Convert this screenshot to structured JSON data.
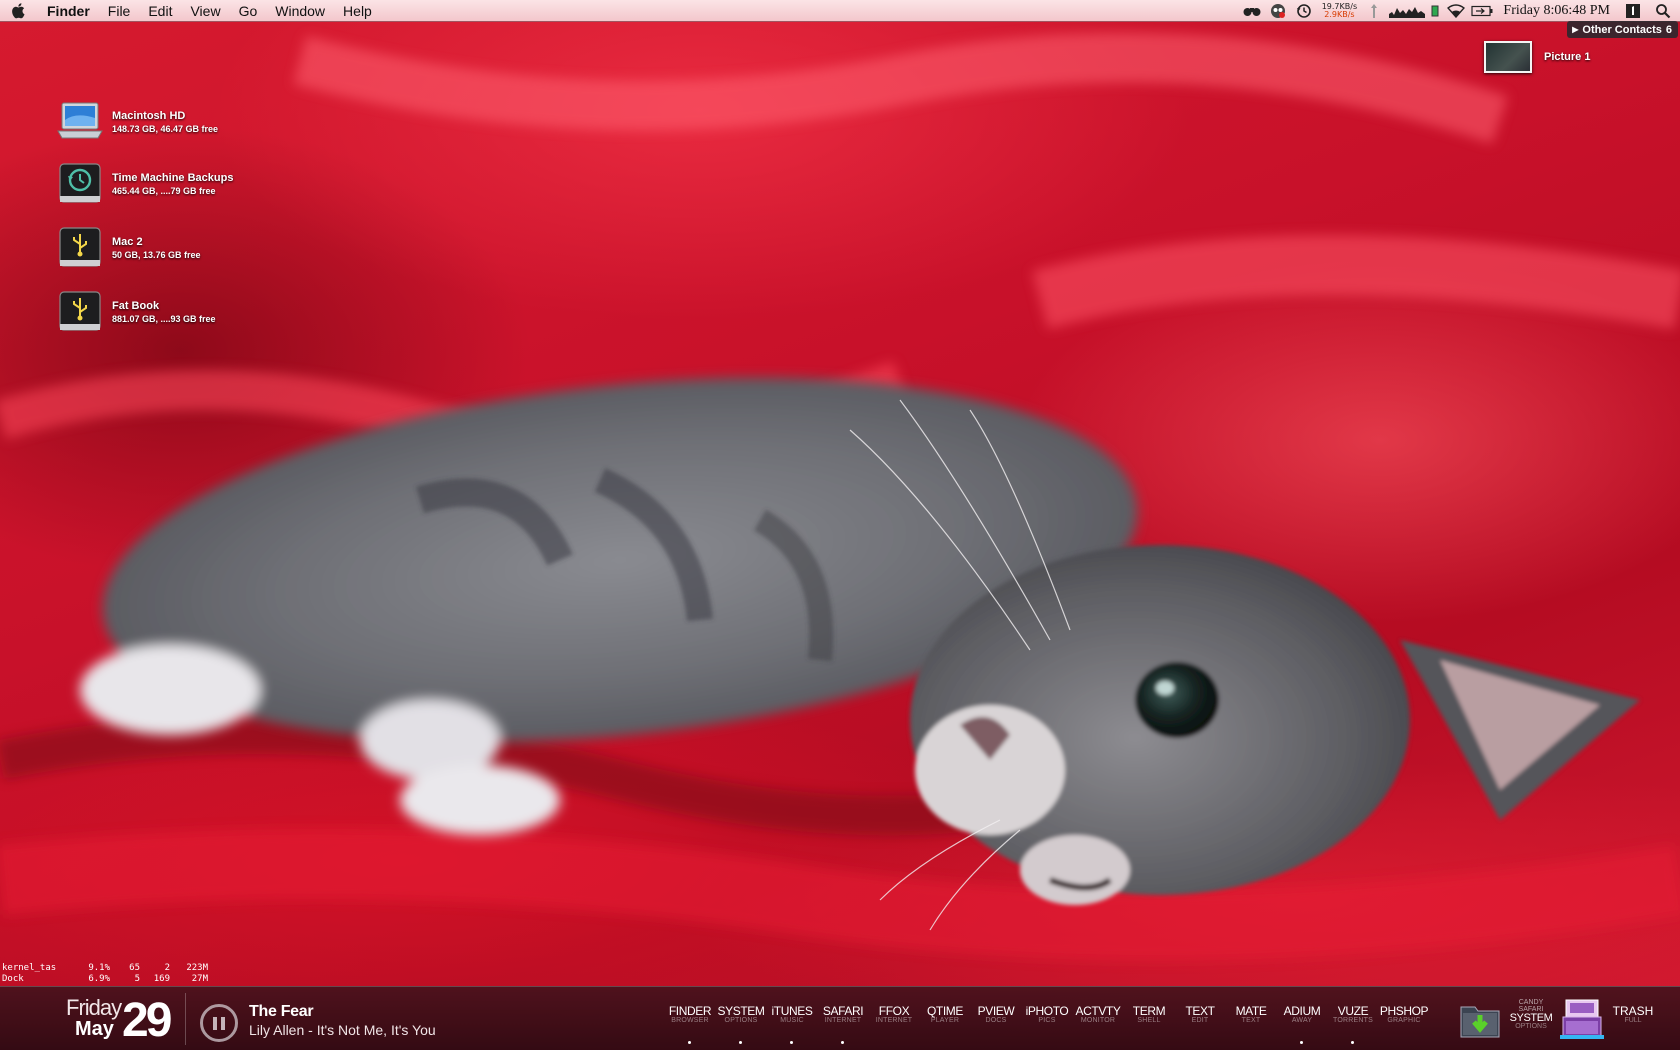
{
  "menubar": {
    "app_name": "Finder",
    "menus": [
      "File",
      "Edit",
      "View",
      "Go",
      "Window",
      "Help"
    ],
    "netspeed_up": "19.7KB/s",
    "netspeed_down": "2.9KB/s",
    "clock": "Friday 8:06:48 PM",
    "status_icons": [
      "binoculars-icon",
      "growl-icon",
      "time-machine-icon",
      "arrows-icon",
      "activity-graph-icon",
      "battery-small-icon",
      "wifi-icon",
      "battery-icon",
      "spaces-icon",
      "spotlight-icon"
    ]
  },
  "contacts": {
    "label": "Other Contacts",
    "count": "6"
  },
  "desktop": {
    "picture": {
      "name": "Picture 1"
    },
    "volumes": [
      {
        "name": "Macintosh HD",
        "info": "148.73 GB, 46.47 GB free",
        "icon": "laptop-drive-icon"
      },
      {
        "name": "Time Machine Backups",
        "info": "465.44 GB, ....79 GB free",
        "icon": "time-machine-drive-icon"
      },
      {
        "name": "Mac 2",
        "info": "50 GB, 13.76 GB free",
        "icon": "usb-drive-icon"
      },
      {
        "name": "Fat Book",
        "info": "881.07 GB, ....93 GB free",
        "icon": "usb-drive-icon"
      }
    ]
  },
  "processes": [
    {
      "name": "kernel_tas",
      "cpu": "9.1%",
      "threads": "65",
      "ports": "2",
      "mem": "223M"
    },
    {
      "name": "Dock",
      "cpu": "6.9%",
      "threads": "5",
      "ports": "169",
      "mem": "27M"
    }
  ],
  "dock": {
    "date": {
      "weekday": "Friday",
      "month": "May",
      "day": "29"
    },
    "now_playing": {
      "title": "The Fear",
      "artist": "Lily Allen - It's Not Me, It's You"
    },
    "apps": [
      {
        "label": "FINDER",
        "sub": "BROWSER",
        "running": true
      },
      {
        "label": "SYSTEM",
        "sub": "OPTIONS",
        "running": true
      },
      {
        "label": "iTUNES",
        "sub": "MUSIC",
        "running": true
      },
      {
        "label": "SAFARI",
        "sub": "INTERNET",
        "running": true
      },
      {
        "label": "FFOX",
        "sub": "INTERNET",
        "running": false
      },
      {
        "label": "QTIME",
        "sub": "PLAYER",
        "running": false
      },
      {
        "label": "PVIEW",
        "sub": "DOCS",
        "running": false
      },
      {
        "label": "iPHOTO",
        "sub": "PICS",
        "running": false
      },
      {
        "label": "ACTVTY",
        "sub": "MONITOR",
        "running": false
      },
      {
        "label": "TERM",
        "sub": "SHELL",
        "running": false
      },
      {
        "label": "TEXT",
        "sub": "EDIT",
        "running": false
      },
      {
        "label": "MATE",
        "sub": "TEXT",
        "running": false
      },
      {
        "label": "ADIUM",
        "sub": "AWAY",
        "running": true
      },
      {
        "label": "VUZE",
        "sub": "TORRENTS",
        "running": true
      },
      {
        "label": "PHSHOP",
        "sub": "GRAPHIC",
        "running": false
      }
    ],
    "candy": {
      "tiny1": "CANDY",
      "tiny2": "SAFARI",
      "label": "SYSTEM",
      "sub": "OPTIONS"
    },
    "trash": {
      "label": "TRASH",
      "sub": "FULL"
    },
    "colors": {
      "background": "#3a0e16",
      "accent": "#ffffff"
    }
  }
}
